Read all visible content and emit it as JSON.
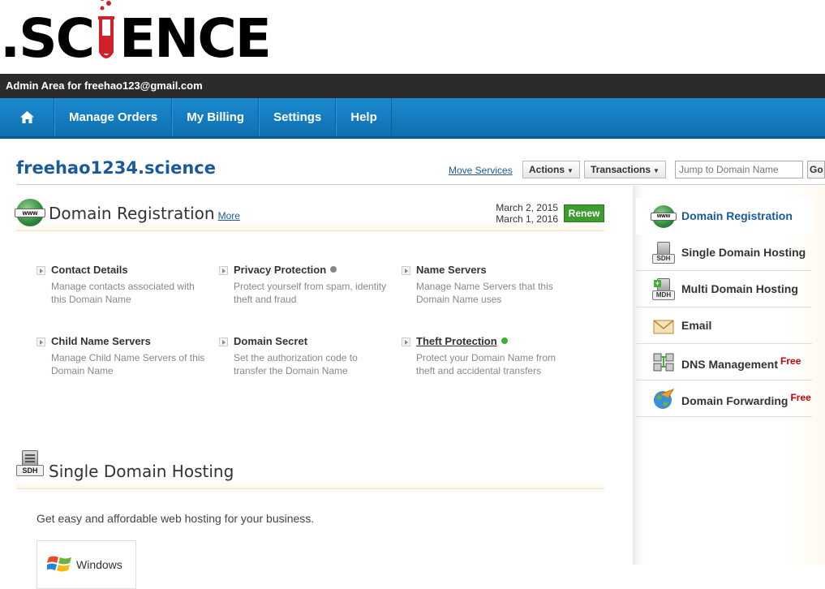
{
  "brand": {
    "logo_left": ".SC",
    "logo_right": "ENCE"
  },
  "admin_bar": {
    "text": "Admin Area for freehao123@gmail.com"
  },
  "nav": {
    "home_icon": "home-icon",
    "items": [
      {
        "label": "Manage Orders"
      },
      {
        "label": "My Billing"
      },
      {
        "label": "Settings"
      },
      {
        "label": "Help"
      }
    ]
  },
  "header": {
    "domain": "freehao1234.science",
    "move_services": "Move Services",
    "actions_label": "Actions",
    "transactions_label": "Transactions",
    "jump_placeholder": "Jump to Domain Name",
    "go_label": "Go"
  },
  "domain_registration": {
    "title": "Domain Registration",
    "more": "More",
    "date_registered": "March 2, 2015",
    "date_expires": "March 1, 2016",
    "renew_label": "Renew",
    "items": [
      {
        "title": "Contact Details",
        "desc": "Manage contacts associated with this Domain Name"
      },
      {
        "title": "Privacy Protection",
        "desc": "Protect yourself from spam, identity theft and fraud",
        "status_color": "#888888"
      },
      {
        "title": "Name Servers",
        "desc": "Manage Name Servers that this Domain Name uses"
      },
      {
        "title": "Child Name Servers",
        "desc": "Manage Child Name Servers of this Domain Name"
      },
      {
        "title": "Domain Secret",
        "desc": "Set the authorization code to transfer the Domain Name"
      },
      {
        "title": "Theft Protection",
        "desc": "Protect your Domain Name from theft and accidental transfers",
        "status_color": "#3cb030"
      }
    ]
  },
  "single_domain_hosting": {
    "title": "Single Domain Hosting",
    "icon_label": "SDH",
    "description": "Get easy and affordable web hosting for your business.",
    "windows_label": "Windows"
  },
  "sidebar": {
    "items": [
      {
        "label": "Domain Registration",
        "icon": "www-globe-icon",
        "active": true
      },
      {
        "label": "Single Domain Hosting",
        "icon": "sdh-server-icon",
        "icon_text": "SDH"
      },
      {
        "label": "Multi Domain Hosting",
        "icon": "mdh-server-icon",
        "icon_text": "MDH"
      },
      {
        "label": "Email",
        "icon": "envelope-icon"
      },
      {
        "label": "DNS Management",
        "icon": "dns-network-icon",
        "badge": "Free"
      },
      {
        "label": "Domain Forwarding",
        "icon": "globe-arrow-icon",
        "badge": "Free"
      }
    ]
  },
  "colors": {
    "nav_blue": "#1478be",
    "admin_bar": "#2b2b2b",
    "renew_green": "#3c9c2e",
    "link_blue": "#1a5a99",
    "free_red": "#cc0000"
  }
}
